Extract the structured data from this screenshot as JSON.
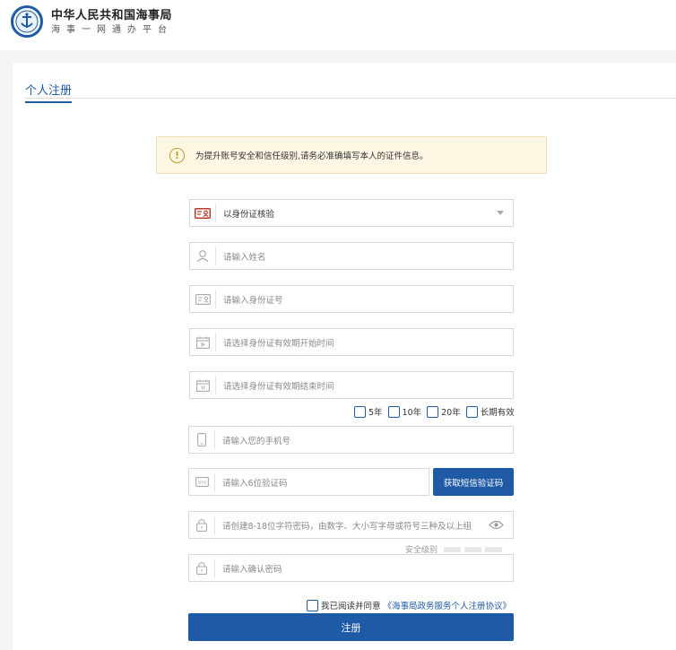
{
  "header": {
    "brand_title": "中华人民共和国海事局",
    "brand_subtitle": "海事一网通办平台",
    "logo_label": "CHINA MSA"
  },
  "tab": {
    "label": "个人注册"
  },
  "notice": {
    "text": "为提升账号安全和信任级别,请务必准确填写本人的证件信息。"
  },
  "form": {
    "verify_method": {
      "value": "以身份证核验",
      "icon": "id-card-icon"
    },
    "name": {
      "placeholder": "请输入姓名",
      "icon": "user-icon"
    },
    "id_number": {
      "placeholder": "请输入身份证号",
      "icon": "id-card-outline-icon"
    },
    "id_start": {
      "placeholder": "请选择身份证有效期开始时间",
      "icon": "calendar-icon"
    },
    "id_end": {
      "placeholder": "请选择身份证有效期结束时间",
      "icon": "calendar-icon"
    },
    "validity_options": [
      "5年",
      "10年",
      "20年",
      "长期有效"
    ],
    "phone": {
      "placeholder": "请输入您的手机号",
      "icon": "mobile-icon"
    },
    "sms_code": {
      "placeholder": "请输入6位验证码",
      "icon": "sms-icon"
    },
    "sms_button": "获取短信验证码",
    "password": {
      "placeholder": "请创建8-18位字符密码，由数字、大小写字母或符号三种及以上组",
      "icon": "lock-icon"
    },
    "strength_label": "安全级别",
    "confirm_password": {
      "placeholder": "请输入确认密码",
      "icon": "lock-icon"
    },
    "agree_prefix": "我已阅读并同意",
    "agree_link": "《海事局政务服务个人注册协议》",
    "submit": "注册"
  },
  "colors": {
    "primary": "#1f5aa6",
    "notice_bg": "#fdf6e3",
    "notice_icon": "#c49a2c"
  }
}
